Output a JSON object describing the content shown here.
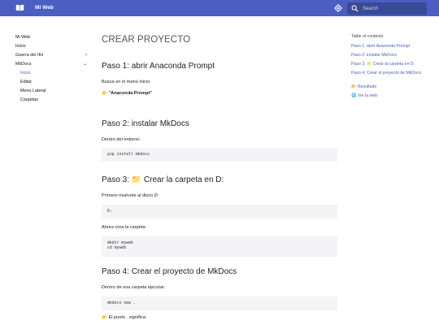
{
  "header": {
    "site_title": "Mi Web",
    "search_placeholder": "Search",
    "brand_color": "#4a5fc1"
  },
  "nav": {
    "items": [
      {
        "label": "Mi Web"
      },
      {
        "label": "Inicio"
      },
      {
        "label": "Guerra del Ifni",
        "chevron": "›"
      },
      {
        "label": "MkDocs",
        "chevron": "⌄"
      },
      {
        "label": "Inicio"
      },
      {
        "label": "Editar"
      },
      {
        "label": "Menu Lateral"
      },
      {
        "label": "Carpetas"
      }
    ]
  },
  "content": {
    "title": "CREAR PROYECTO",
    "step1": {
      "heading": "Paso 1: abrir Anaconda Prompt",
      "text": "Busca en el menú inicio:",
      "emoji": "👉",
      "bold": "\"Anaconda Prompt\""
    },
    "step2": {
      "heading": "Paso 2: instalar MkDocs",
      "text": "Dentro del entorno:",
      "code": "pip install mkdocs"
    },
    "step3": {
      "heading_emoji": "📁",
      "heading": "Paso 3: 📁 Crear la carpeta en D:",
      "text1": "Primero muévete al disco D:",
      "code1": "D:",
      "text2": "Ahora crea la carpeta:",
      "code2": "mkdir myweb\ncd myweb"
    },
    "step4": {
      "heading": "Paso 4: Crear el proyecto de MkDocs",
      "text": "Dentro de esa carpeta ejecutar:",
      "code": "mkdocs new .",
      "partial": "👉 El punto . significa:"
    }
  },
  "toc": {
    "title": "Table of contents",
    "items": [
      {
        "label": "Paso 1: abrir Anaconda Prompt"
      },
      {
        "label": "Paso 2: instalar MkDocs"
      },
      {
        "label": "Paso 3: 📁 Crear la carpeta en D:"
      },
      {
        "label": "Paso 4: Crear el proyecto de MkDocs"
      },
      {
        "label": "📂 Resultado"
      },
      {
        "label": "🌐 Ver la web"
      }
    ]
  }
}
